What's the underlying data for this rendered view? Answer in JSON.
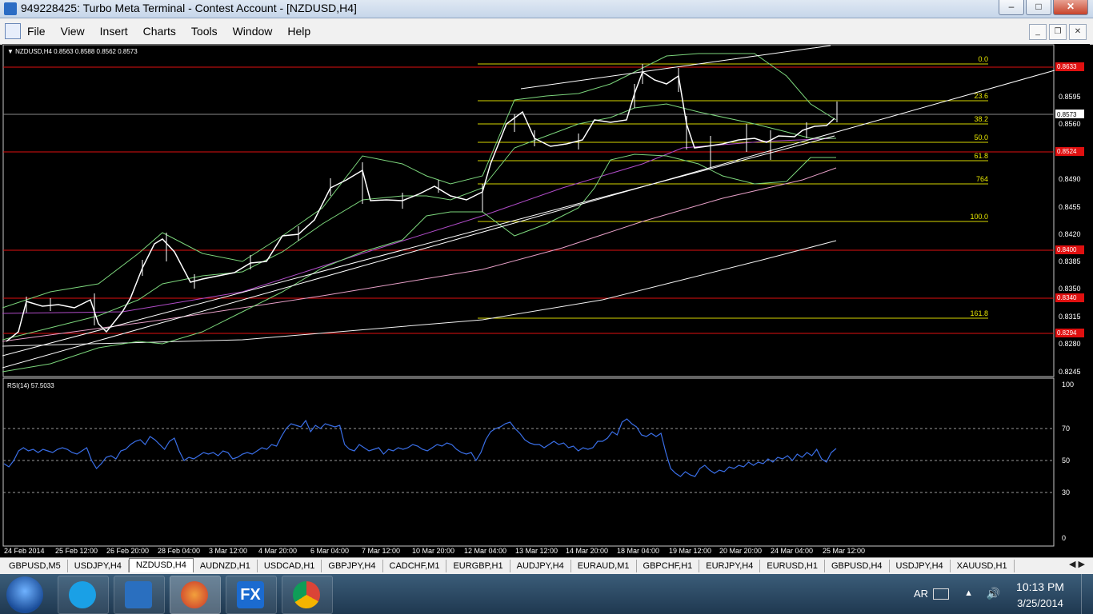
{
  "window": {
    "title": "949228425: Turbo Meta Terminal - Contest Account - [NZDUSD,H4]"
  },
  "menu": [
    "File",
    "View",
    "Insert",
    "Charts",
    "Tools",
    "Window",
    "Help"
  ],
  "chart": {
    "header": "NZDUSD,H4  0.8563 0.8588 0.8562 0.8573",
    "symbol": "NZDUSD",
    "timeframe": "H4",
    "ohlc": {
      "open": 0.8563,
      "high": 0.8588,
      "low": 0.8562,
      "close": 0.8573
    },
    "current_price": "0.8573",
    "price_axis": [
      "0.8595",
      "0.8560",
      "0.8490",
      "0.8455",
      "0.8420",
      "0.8385",
      "0.8350",
      "0.8315",
      "0.8280",
      "0.8245"
    ],
    "red_levels": [
      "0.8633",
      "0.8524",
      "0.8400",
      "0.8340",
      "0.8294"
    ],
    "fib_levels": [
      "0.0",
      "23.6",
      "38.2",
      "50.0",
      "61.8",
      "764",
      "100.0",
      "161.8"
    ],
    "time_axis": [
      "24 Feb 2014",
      "25 Feb 12:00",
      "26 Feb 20:00",
      "28 Feb 04:00",
      "3 Mar 12:00",
      "4 Mar 20:00",
      "6 Mar 04:00",
      "7 Mar 12:00",
      "10 Mar 20:00",
      "12 Mar 04:00",
      "13 Mar 12:00",
      "14 Mar 20:00",
      "18 Mar 04:00",
      "19 Mar 12:00",
      "20 Mar 20:00",
      "24 Mar 04:00",
      "25 Mar 12:00"
    ]
  },
  "rsi": {
    "label": "RSI(14) 57.5033",
    "period": 14,
    "value": 57.5033,
    "levels": [
      "100",
      "70",
      "50",
      "30",
      "0"
    ],
    "color": "#3a6fe8"
  },
  "chart_data": {
    "type": "line",
    "title": "NZDUSD,H4",
    "ylim": [
      0.8235,
      0.866
    ],
    "rsi_values": [
      48,
      46,
      50,
      56,
      58,
      56,
      57,
      55,
      57,
      56,
      55,
      57,
      58,
      57,
      55,
      54,
      56,
      58,
      50,
      45,
      48,
      52,
      53,
      51,
      56,
      57,
      60,
      62,
      63,
      60,
      65,
      63,
      60,
      57,
      62,
      64,
      56,
      50,
      52,
      51,
      53,
      55,
      54,
      55,
      53,
      56,
      55,
      51,
      52,
      54,
      55,
      54,
      56,
      58,
      57,
      60,
      59,
      65,
      70,
      73,
      72,
      71,
      75,
      68,
      72,
      70,
      73,
      72,
      71,
      72,
      60,
      57,
      56,
      60,
      58,
      56,
      57,
      58,
      54,
      57,
      56,
      58,
      57,
      58,
      60,
      59,
      57,
      56,
      58,
      60,
      59,
      61,
      60,
      57,
      55,
      54,
      55,
      50,
      55,
      63,
      68,
      70,
      71,
      73,
      74,
      70,
      67,
      63,
      61,
      60,
      60,
      58,
      60,
      62,
      60,
      61,
      58,
      59,
      56,
      58,
      57,
      58,
      62,
      62,
      64,
      68,
      66,
      74,
      76,
      73,
      71,
      66,
      65,
      67,
      65,
      67,
      55,
      45,
      42,
      40,
      43,
      41,
      40,
      45,
      47,
      44,
      42,
      44,
      43,
      46,
      45,
      47,
      46,
      49,
      47,
      49,
      48,
      51,
      49,
      52,
      51,
      53,
      50,
      54,
      52,
      55,
      53,
      57,
      51,
      49,
      55,
      57.5
    ]
  }
}
